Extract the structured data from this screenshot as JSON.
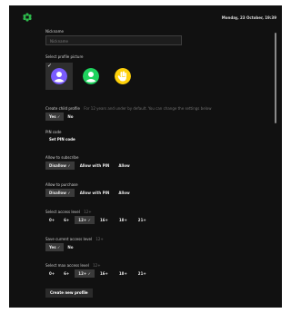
{
  "header": {
    "date": "Monday, 23 October, 19:39",
    "logo_icon": "green-flower-logo",
    "logo_color": "#2db84b"
  },
  "nickname": {
    "label": "Nickname",
    "placeholder": "Nickname",
    "value": ""
  },
  "profile_picture": {
    "label": "Select profile picture",
    "avatars": [
      {
        "name": "avatar-purple-person",
        "color": "#7a5cff",
        "selected": true
      },
      {
        "name": "avatar-green-person",
        "color": "#1fd35e",
        "selected": false
      },
      {
        "name": "avatar-yellow-hand",
        "color": "#ffd10a",
        "selected": false
      }
    ],
    "check_mark": "✓"
  },
  "child_profile": {
    "label": "Create child profile",
    "hint": "For 12 years and under by default. You can change the settings below",
    "options": [
      "Yes ✓",
      "No"
    ]
  },
  "pin": {
    "label": "PIN code",
    "button": "Set PIN code"
  },
  "subscribe": {
    "label": "Allow to subscribe",
    "options": [
      "Disallow ✓",
      "Allow with PIN",
      "Allow"
    ]
  },
  "purchase": {
    "label": "Allow to purchase",
    "options": [
      "Disallow ✓",
      "Allow with PIN",
      "Allow"
    ]
  },
  "access_level": {
    "label": "Select access level",
    "hint": "12+",
    "options": [
      "0+",
      "6+",
      "12+ ✓",
      "16+",
      "18+",
      "21+"
    ]
  },
  "save_access": {
    "label": "Save current access level",
    "hint": "12+",
    "options": [
      "Yes ✓",
      "No"
    ]
  },
  "max_access": {
    "label": "Select max access level",
    "hint": "12+",
    "options": [
      "0+",
      "6+",
      "12+ ✓",
      "16+",
      "18+",
      "21+"
    ]
  },
  "footer": {
    "create_button": "Create new profile"
  },
  "colors": {
    "background": "#111111",
    "selected_option": "#3a3a3a",
    "input_bg": "#1d1d1d"
  }
}
